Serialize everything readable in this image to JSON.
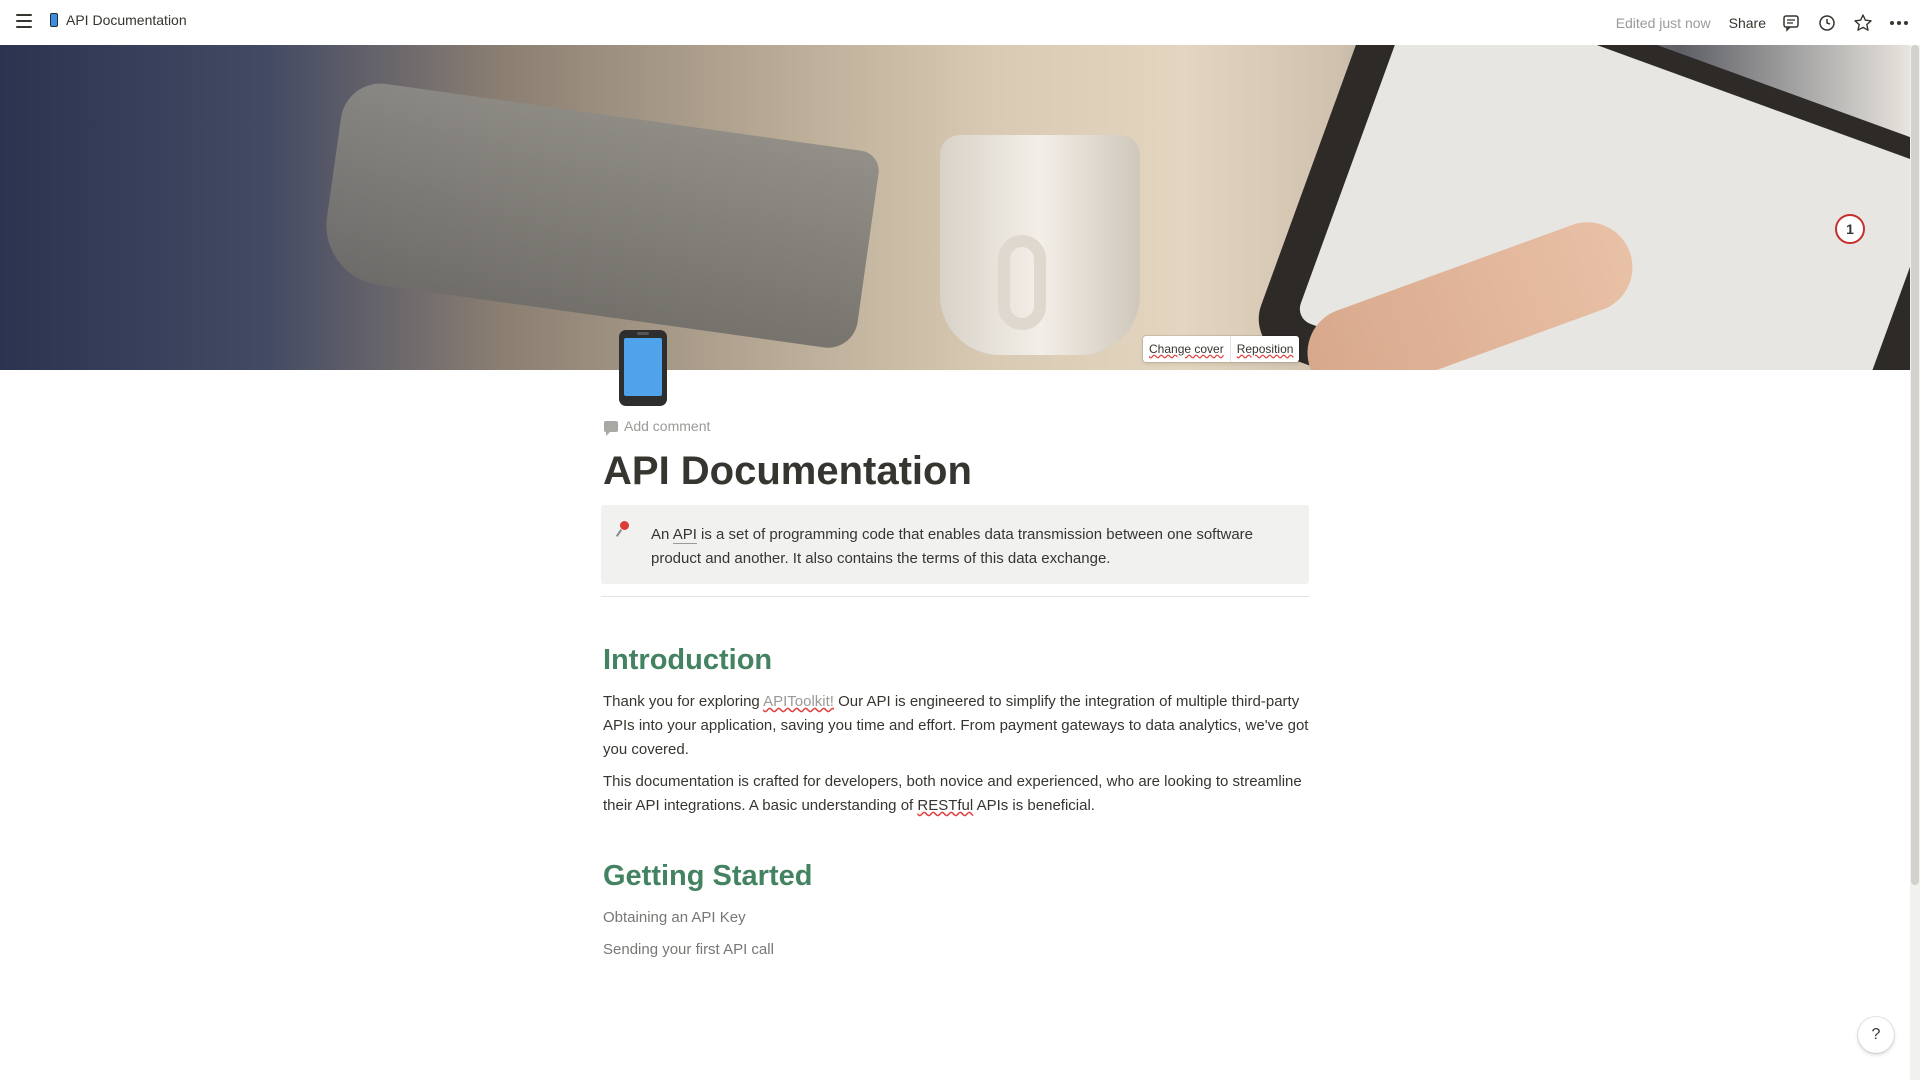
{
  "topbar": {
    "breadcrumb_title": "API Documentation",
    "edited": "Edited just now",
    "share": "Share"
  },
  "cover": {
    "change_cover": "Change cover",
    "reposition": "Reposition",
    "badge": "1"
  },
  "page": {
    "add_comment": "Add comment",
    "title": "API Documentation",
    "callout": {
      "part1": "An ",
      "api_link": "API",
      "part2": " is a set of programming code that enables data transmission between one software product and another. It also contains the terms of this data exchange."
    },
    "intro": {
      "heading": "Introduction",
      "p1_a": "Thank you for exploring ",
      "p1_link": "APIToolkit!",
      "p1_b": " Our API is engineered to simplify the integration of multiple third-party APIs into your application, saving you time and effort. From payment gateways to data analytics, we've got you covered.",
      "p2_a": "This documentation is crafted for developers, both novice and experienced, who are looking to streamline their API integrations. A basic understanding of ",
      "p2_word": "RESTful",
      "p2_b": " APIs is beneficial."
    },
    "getting_started": {
      "heading": "Getting Started",
      "items": [
        "Obtaining an API Key",
        "Sending your first API call"
      ]
    }
  },
  "help": "?",
  "colors": {
    "heading_green": "#448361",
    "callout_bg": "#f1f1ef",
    "text": "#37352f",
    "muted": "#9b9a97"
  },
  "icons": {
    "menu": "menu-icon",
    "page": "mobile-phone-icon",
    "comments": "comments-icon",
    "history": "clock-icon",
    "favorite": "star-icon",
    "more": "more-icon",
    "callout": "pushpin-icon"
  }
}
